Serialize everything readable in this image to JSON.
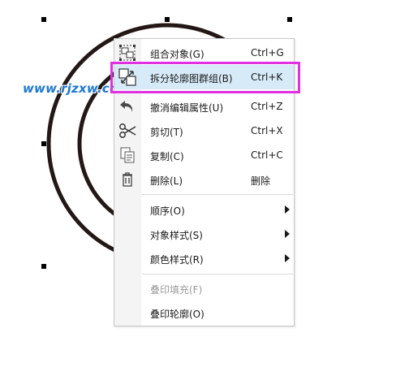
{
  "watermark": "www.rjzxw.com",
  "colors": {
    "highlight_box": "#e030e0",
    "watermark": "#1e78d2",
    "hover_bg": "#d6eaf8"
  },
  "menu": {
    "items": [
      {
        "label": "组合对象(G)",
        "shortcut": "Ctrl+G",
        "icon": "group-objects-icon",
        "enabled": true
      },
      {
        "label": "拆分轮廓图群组(B)",
        "shortcut": "Ctrl+K",
        "icon": "break-apart-icon",
        "enabled": true,
        "highlighted": true
      },
      {
        "label": "撤消编辑属性(U)",
        "shortcut": "Ctrl+Z",
        "icon": "undo-icon",
        "enabled": true
      },
      {
        "label": "剪切(T)",
        "shortcut": "Ctrl+X",
        "icon": "scissors-icon",
        "enabled": true
      },
      {
        "label": "复制(C)",
        "shortcut": "Ctrl+C",
        "icon": "copy-icon",
        "enabled": true
      },
      {
        "label": "删除(L)",
        "shortcut": "删除",
        "icon": "trash-icon",
        "enabled": true
      },
      {
        "label": "顺序(O)",
        "submenu": true,
        "enabled": true
      },
      {
        "label": "对象样式(S)",
        "submenu": true,
        "enabled": true
      },
      {
        "label": "颜色样式(R)",
        "submenu": true,
        "enabled": true
      },
      {
        "label": "叠印填充(F)",
        "enabled": false
      },
      {
        "label": "叠印轮廓(O)",
        "enabled": true
      }
    ]
  }
}
